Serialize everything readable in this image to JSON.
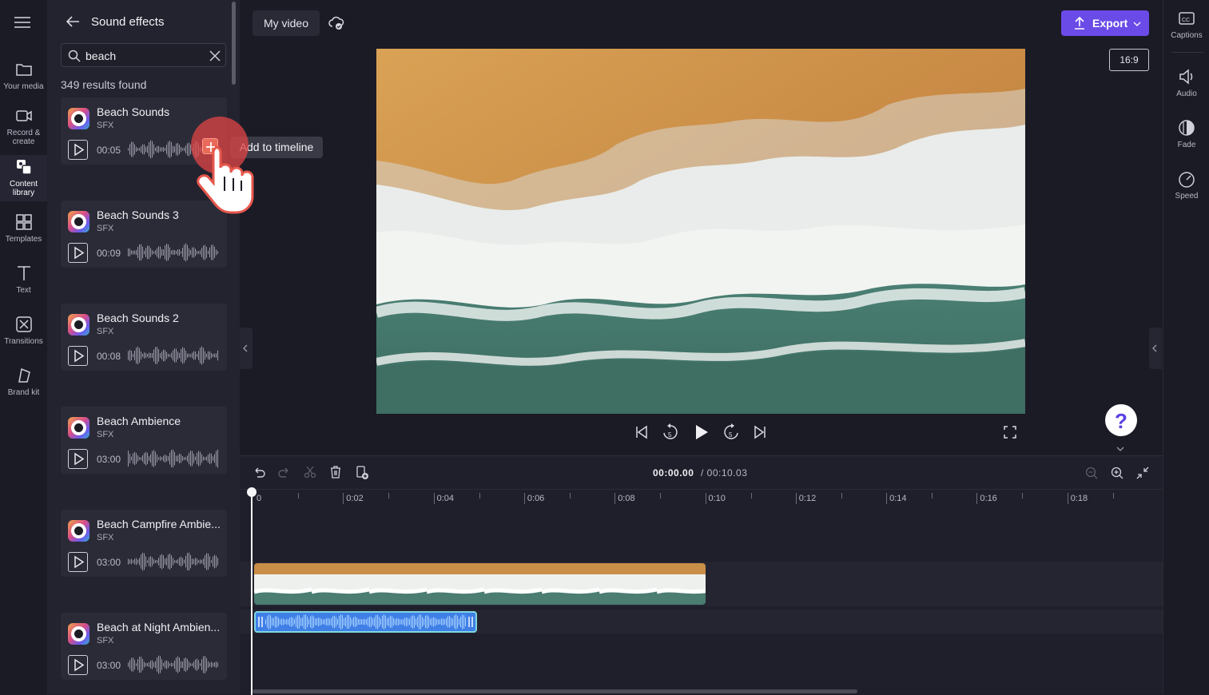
{
  "nav": {
    "items": [
      {
        "label": "Your media",
        "icon": "folder-icon"
      },
      {
        "label": "Record & create",
        "icon": "camera-icon"
      },
      {
        "label": "Content library",
        "icon": "library-icon"
      },
      {
        "label": "Templates",
        "icon": "templates-icon"
      },
      {
        "label": "Text",
        "icon": "text-icon"
      },
      {
        "label": "Transitions",
        "icon": "transitions-icon"
      },
      {
        "label": "Brand kit",
        "icon": "brand-kit-icon"
      }
    ]
  },
  "panel": {
    "title": "Sound effects",
    "search_value": "beach",
    "results_text": "349 results found",
    "tooltip": "Add to timeline",
    "items": [
      {
        "name": "Beach Sounds",
        "type": "SFX",
        "duration": "00:05"
      },
      {
        "name": "Beach Sounds 3",
        "type": "SFX",
        "duration": "00:09"
      },
      {
        "name": "Beach Sounds 2",
        "type": "SFX",
        "duration": "00:08"
      },
      {
        "name": "Beach Ambience",
        "type": "SFX",
        "duration": "03:00"
      },
      {
        "name": "Beach Campfire Ambie...",
        "type": "SFX",
        "duration": "03:00"
      },
      {
        "name": "Beach at Night Ambien...",
        "type": "SFX",
        "duration": "03:00"
      }
    ]
  },
  "header": {
    "project_title": "My video",
    "export_label": "Export",
    "aspect_ratio": "16:9"
  },
  "right_panel": {
    "items": [
      {
        "label": "Captions",
        "icon": "captions-icon"
      },
      {
        "label": "Audio",
        "icon": "audio-icon"
      },
      {
        "label": "Fade",
        "icon": "fade-icon"
      },
      {
        "label": "Speed",
        "icon": "speed-icon"
      }
    ]
  },
  "timeline": {
    "current_time": "00:00.00",
    "total_time": "/ 00:10.03",
    "ticks": [
      "0",
      "0:02",
      "0:04",
      "0:06",
      "0:08",
      "0:10",
      "0:12",
      "0:14",
      "0:16",
      "0:18"
    ]
  },
  "colors": {
    "accent": "#6a4be8",
    "audio_clip": "#3f7fe6",
    "background": "#1b1b26"
  }
}
